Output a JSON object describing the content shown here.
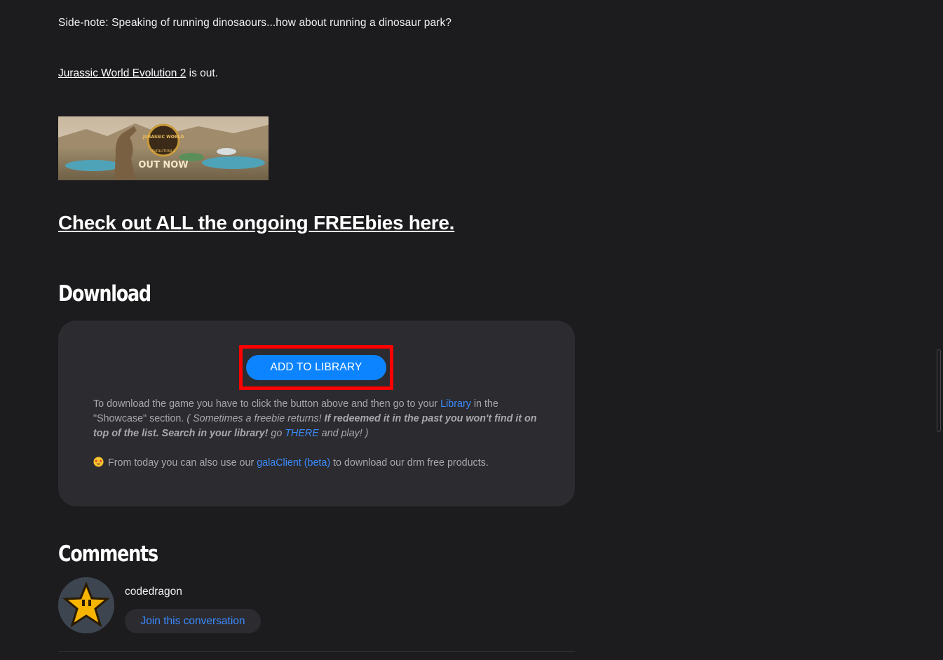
{
  "article": {
    "sidenote": "Side-note: Speaking of running dinosaours...how about running a dinosaur park?",
    "jw_link": "Jurassic World Evolution 2",
    "jw_suffix": " is out.",
    "banner_logo_text": "JURASSIC WORLD",
    "banner_sub_text": "EVOLUTION 2",
    "banner_outnow": "OUT NOW",
    "freebies_link": "Check out ALL the ongoing FREEbies here."
  },
  "download": {
    "heading": "Download",
    "button_label": "ADD TO LIBRARY",
    "text_1": "To download the game you have to click the button above and then go to your ",
    "library_link": "Library",
    "text_2": " in the \"Showcase\" section. ",
    "italic_1": "( Sometimes a freebie returns! ",
    "bold_italic": "If redeemed it in the past you won't find it on top of the list. Search in your library!",
    "italic_2": " go ",
    "there_link": "THERE",
    "italic_3": " and play! )",
    "client_text_1": "From today you can also use our ",
    "client_link": "galaClient (beta)",
    "client_text_2": " to download our drm free products."
  },
  "comments": {
    "heading": "Comments",
    "username": "codedragon",
    "join_label": "Join this conversation"
  },
  "colors": {
    "background": "#1c1b1d",
    "panel": "#2c2b2f",
    "accent": "#0d84ff",
    "link": "#3a8bff",
    "highlight": "#ff0000"
  },
  "icons": {
    "emoji": "star-struck-emoji-icon",
    "avatar": "star-avatar-icon"
  }
}
